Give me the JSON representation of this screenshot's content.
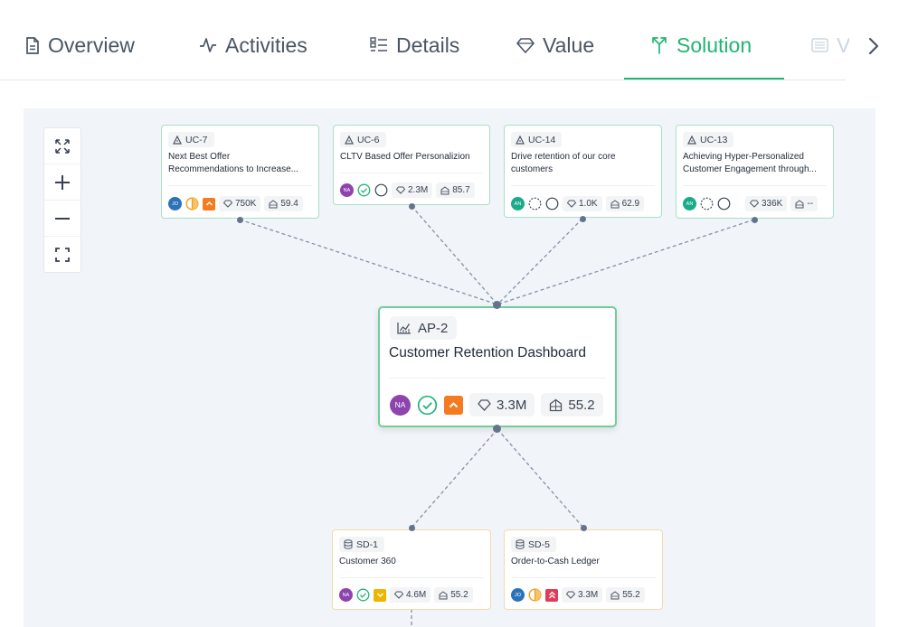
{
  "tabs": [
    {
      "label": "Overview",
      "icon": "document-icon",
      "active": false
    },
    {
      "label": "Activities",
      "icon": "activity-icon",
      "active": false
    },
    {
      "label": "Details",
      "icon": "details-list-icon",
      "active": false
    },
    {
      "label": "Value",
      "icon": "diamond-icon",
      "active": false
    },
    {
      "label": "Solution",
      "icon": "branch-icon",
      "active": true
    },
    {
      "label": "V",
      "icon": "list-icon",
      "active": false
    }
  ],
  "colors": {
    "accent": "#22b573",
    "usecase_border": "#a9dfc7",
    "dataset_border": "#f5d8ad",
    "avatar_blue": "#2a73b8",
    "avatar_purple": "#8e44ad",
    "avatar_teal": "#1aab8a",
    "priority_orange": "#f47b20",
    "priority_yellow": "#f0b400",
    "priority_red": "#e23a5b"
  },
  "usecases": [
    {
      "id": "UC-7",
      "title_lines": [
        "Next Best Offer",
        "Recommendations to Increase..."
      ],
      "avatar": "JO",
      "value": "750K",
      "score": "59.4"
    },
    {
      "id": "UC-6",
      "title_lines": [
        "CLTV Based Offer Personalizion"
      ],
      "avatar": "NA",
      "value": "2.3M",
      "score": "85.7"
    },
    {
      "id": "UC-14",
      "title_lines": [
        "Drive retention of our core",
        "customers"
      ],
      "avatar": "AN",
      "value": "1.0K",
      "score": "62.9"
    },
    {
      "id": "UC-13",
      "title_lines": [
        "Achieving Hyper-Personalized",
        "Customer Engagement through..."
      ],
      "avatar": "AN",
      "value": "336K",
      "score": "--"
    }
  ],
  "main": {
    "id": "AP-2",
    "title": "Customer Retention Dashboard",
    "avatar": "NA",
    "value": "3.3M",
    "score": "55.2"
  },
  "datasets": [
    {
      "id": "SD-1",
      "title": "Customer 360",
      "avatar": "NA",
      "value": "4.6M",
      "score": "55.2"
    },
    {
      "id": "SD-5",
      "title": "Order-to-Cash Ledger",
      "avatar": "JO",
      "value": "3.3M",
      "score": "55.2"
    }
  ]
}
